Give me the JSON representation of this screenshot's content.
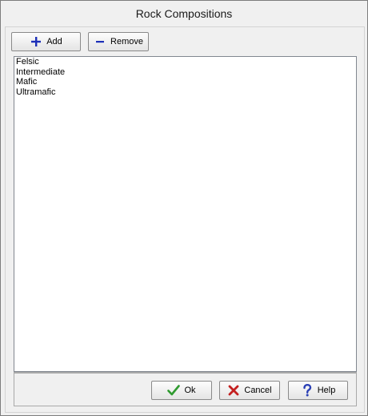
{
  "window": {
    "title": "Rock Compositions"
  },
  "toolbar": {
    "add_label": "Add",
    "add_icon": "plus-icon",
    "remove_label": "Remove",
    "remove_icon": "minus-icon"
  },
  "list": {
    "items": [
      "Felsic",
      "Intermediate",
      "Mafic",
      "Ultramafic"
    ]
  },
  "footer": {
    "ok_label": "Ok",
    "ok_icon": "checkmark-icon",
    "cancel_label": "Cancel",
    "cancel_icon": "x-icon",
    "help_label": "Help",
    "help_icon": "question-mark-icon"
  },
  "colors": {
    "plus": "#1c2fb8",
    "minus": "#1c2fb8",
    "check": "#2f9a2f",
    "x": "#c42020",
    "question": "#2a3fb5"
  }
}
